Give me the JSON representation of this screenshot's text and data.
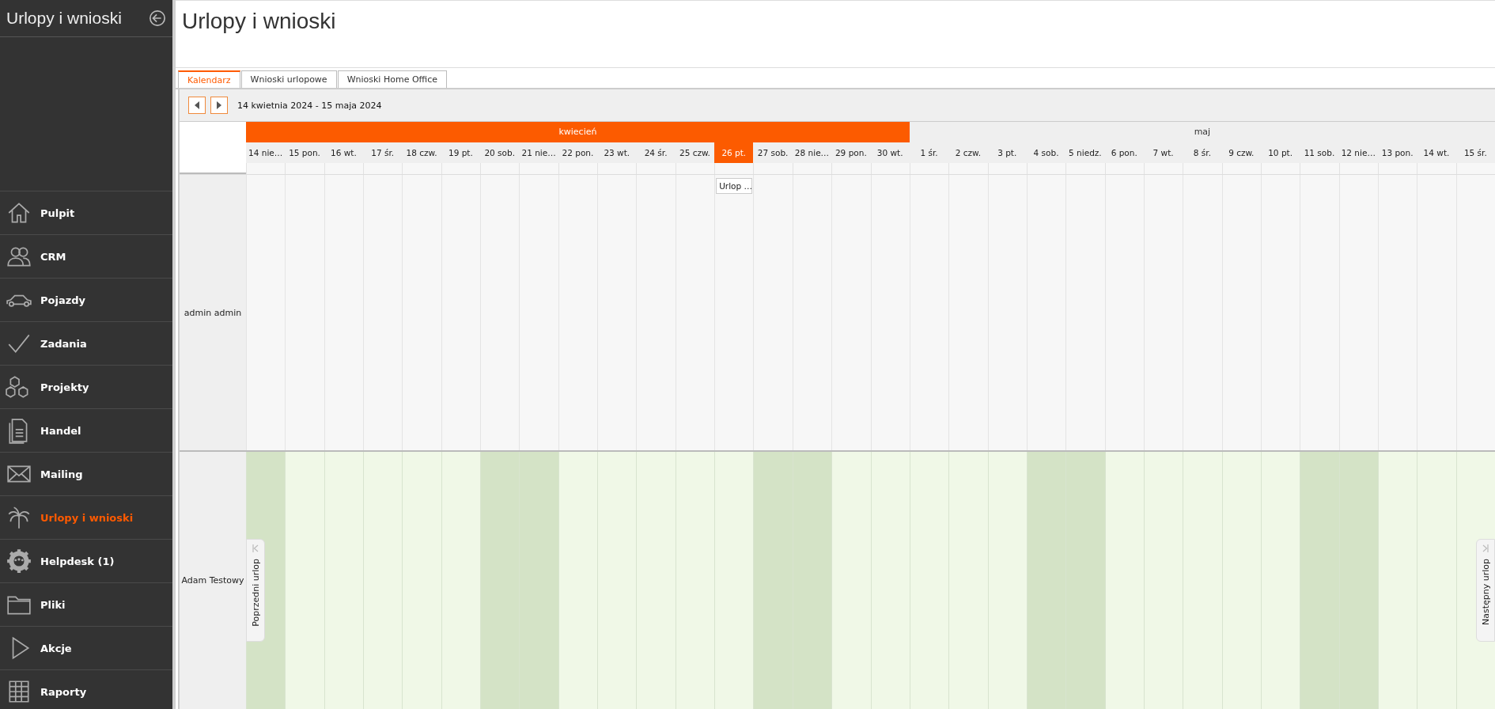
{
  "sidebar": {
    "title": "Urlopy i wnioski",
    "items": [
      {
        "label": "Pulpit",
        "selected": false
      },
      {
        "label": "CRM",
        "selected": false
      },
      {
        "label": "Pojazdy",
        "selected": false
      },
      {
        "label": "Zadania",
        "selected": false
      },
      {
        "label": "Projekty",
        "selected": false
      },
      {
        "label": "Handel",
        "selected": false
      },
      {
        "label": "Mailing",
        "selected": false
      },
      {
        "label": "Urlopy i wnioski",
        "selected": true
      },
      {
        "label": "Helpdesk (1)",
        "selected": false
      },
      {
        "label": "Pliki",
        "selected": false
      },
      {
        "label": "Akcje",
        "selected": false
      },
      {
        "label": "Raporty",
        "selected": false
      }
    ]
  },
  "page": {
    "title": "Urlopy i wnioski"
  },
  "tabs": [
    {
      "label": "Kalendarz",
      "selected": true
    },
    {
      "label": "Wnioski urlopowe",
      "selected": false
    },
    {
      "label": "Wnioski Home Office",
      "selected": false
    }
  ],
  "toolbar": {
    "range": "14 kwietnia 2024 - 15 maja 2024"
  },
  "calendar": {
    "months": [
      {
        "label": "kwiecień",
        "current": true,
        "days": [
          {
            "label": "14 nie…",
            "weekend": true,
            "today": false
          },
          {
            "label": "15 pon.",
            "weekend": false,
            "today": false
          },
          {
            "label": "16 wt.",
            "weekend": false,
            "today": false
          },
          {
            "label": "17 śr.",
            "weekend": false,
            "today": false
          },
          {
            "label": "18 czw.",
            "weekend": false,
            "today": false
          },
          {
            "label": "19 pt.",
            "weekend": false,
            "today": false
          },
          {
            "label": "20 sob.",
            "weekend": true,
            "today": false
          },
          {
            "label": "21 nie…",
            "weekend": true,
            "today": false
          },
          {
            "label": "22 pon.",
            "weekend": false,
            "today": false
          },
          {
            "label": "23 wt.",
            "weekend": false,
            "today": false
          },
          {
            "label": "24 śr.",
            "weekend": false,
            "today": false
          },
          {
            "label": "25 czw.",
            "weekend": false,
            "today": false
          },
          {
            "label": "26 pt.",
            "weekend": false,
            "today": true
          },
          {
            "label": "27 sob.",
            "weekend": true,
            "today": false
          },
          {
            "label": "28 nie…",
            "weekend": true,
            "today": false
          },
          {
            "label": "29 pon.",
            "weekend": false,
            "today": false
          },
          {
            "label": "30 wt.",
            "weekend": false,
            "today": false
          }
        ]
      },
      {
        "label": "maj",
        "current": false,
        "days": [
          {
            "label": "1 śr.",
            "weekend": false,
            "today": false
          },
          {
            "label": "2 czw.",
            "weekend": false,
            "today": false
          },
          {
            "label": "3 pt.",
            "weekend": false,
            "today": false
          },
          {
            "label": "4 sob.",
            "weekend": true,
            "today": false
          },
          {
            "label": "5 niedz.",
            "weekend": true,
            "today": false
          },
          {
            "label": "6 pon.",
            "weekend": false,
            "today": false
          },
          {
            "label": "7 wt.",
            "weekend": false,
            "today": false
          },
          {
            "label": "8 śr.",
            "weekend": false,
            "today": false
          },
          {
            "label": "9 czw.",
            "weekend": false,
            "today": false
          },
          {
            "label": "10 pt.",
            "weekend": false,
            "today": false
          },
          {
            "label": "11 sob.",
            "weekend": true,
            "today": false
          },
          {
            "label": "12 nie…",
            "weekend": true,
            "today": false
          },
          {
            "label": "13 pon.",
            "weekend": false,
            "today": false
          },
          {
            "label": "14 wt.",
            "weekend": false,
            "today": false
          },
          {
            "label": "15 śr.",
            "weekend": false,
            "today": false
          }
        ]
      }
    ],
    "rows": [
      {
        "name": "admin admin",
        "highlighted": false,
        "cells": [
          null,
          null,
          null,
          null,
          null,
          null,
          null,
          null,
          null,
          null,
          null,
          null,
          {
            "event": "Urlop …"
          }
        ]
      },
      {
        "name": "Adam Testowy",
        "highlighted": true,
        "previous": "Poprzedni urlop",
        "next": "Następny urlop"
      }
    ]
  }
}
